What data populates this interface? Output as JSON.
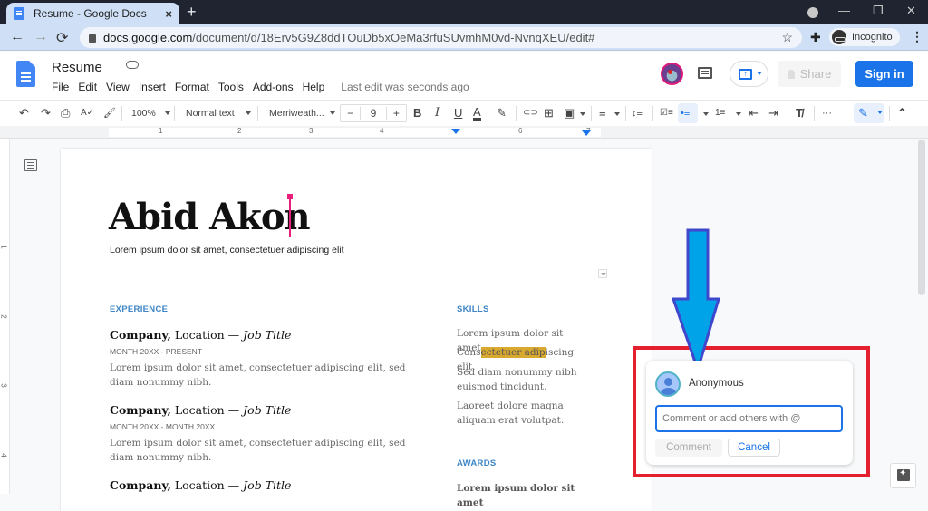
{
  "browser": {
    "tab_title": "Resume - Google Docs",
    "tab_close": "×",
    "new_tab": "+",
    "url_domain": "docs.google.com",
    "url_path": "/document/d/18Erv5G9Z8ddTOuDb5xOeMa3rfuSUvmhM0vd-NvnqXEU/edit#",
    "incognito_label": "Incognito",
    "window_controls": {
      "minimize": "—",
      "restore": "❐",
      "close": "✕"
    },
    "nav": {
      "back": "←",
      "forward": "→",
      "reload": "⟳",
      "star": "☆",
      "extensions": "✚",
      "menu": "⋮"
    }
  },
  "docs": {
    "title": "Resume",
    "menu": [
      "File",
      "Edit",
      "View",
      "Insert",
      "Format",
      "Tools",
      "Add-ons",
      "Help"
    ],
    "last_edit": "Last edit was seconds ago",
    "share_label": "Share",
    "signin_label": "Sign in",
    "present_glyph": "↑"
  },
  "toolbar": {
    "zoom": "100%",
    "style": "Normal text",
    "font": "Merriweath...",
    "font_size": "9",
    "minus": "−",
    "plus": "+",
    "undo": "↶",
    "redo": "↷",
    "print": "⎙",
    "spellcheck": "A✓",
    "paint_format": "🖌",
    "bold": "B",
    "italic": "I",
    "underline": "U",
    "text_color": "A",
    "highlight": "✎",
    "link": "⊂⊃",
    "add_comment": "⊞",
    "image": "▣",
    "align": "≡",
    "line_spacing": "↕≡",
    "checklist": "☑≡",
    "bulleted_list": "•≡",
    "numbered_list": "1≡",
    "decrease_indent": "⇤",
    "increase_indent": "⇥",
    "clear_formatting": "T̸",
    "more": "···",
    "editing_mode": "✎",
    "collapse": "⌃"
  },
  "ruler": {
    "numbers": [
      "1",
      "2",
      "3",
      "4",
      "6",
      "7"
    ],
    "vertical_numbers": [
      "1",
      "2",
      "3",
      "4"
    ]
  },
  "document": {
    "name": "Abid Akon",
    "subtitle": "Lorem ipsum dolor sit amet, consectetuer adipiscing elit",
    "experience_heading": "EXPERIENCE",
    "jobs": [
      {
        "company": "Company,",
        "location": " Location — ",
        "title": "Job Title",
        "dates": "MONTH 20XX - PRESENT",
        "desc": "Lorem ipsum dolor sit amet, consectetuer adipiscing elit, sed diam nonummy nibh."
      },
      {
        "company": "Company,",
        "location": " Location — ",
        "title": "Job Title",
        "dates": "MONTH 20XX - MONTH 20XX",
        "desc": "Lorem ipsum dolor sit amet, consectetuer adipiscing elit, sed diam nonummy nibh."
      },
      {
        "company": "Company,",
        "location": " Location — ",
        "title": "Job Title"
      }
    ],
    "skills_heading": "SKILLS",
    "skills": [
      {
        "text": "Lorem ipsum dolor sit amet."
      },
      {
        "pre": "Cons",
        "highlight": "ectetuer adip",
        "post": "iscing elit."
      },
      {
        "text": "Sed diam nonummy nibh euismod tincidunt."
      },
      {
        "text": "Laoreet dolore magna aliquam erat volutpat."
      }
    ],
    "awards_heading": "AWARDS",
    "awards_first": "Lorem ipsum dolor sit amet"
  },
  "comment": {
    "author": "Anonymous",
    "placeholder": "Comment or add others with @",
    "value": "",
    "comment_label": "Comment",
    "cancel_label": "Cancel"
  },
  "colors": {
    "accent_blue": "#1a73e8",
    "section_heading": "#3d85c6",
    "highlight": "#d9a82e",
    "annotation_red": "#e5202e",
    "annotation_arrow_fill": "#00a2e8",
    "annotation_arrow_stroke": "#3f48cc",
    "cursor": "#e91e7a"
  }
}
